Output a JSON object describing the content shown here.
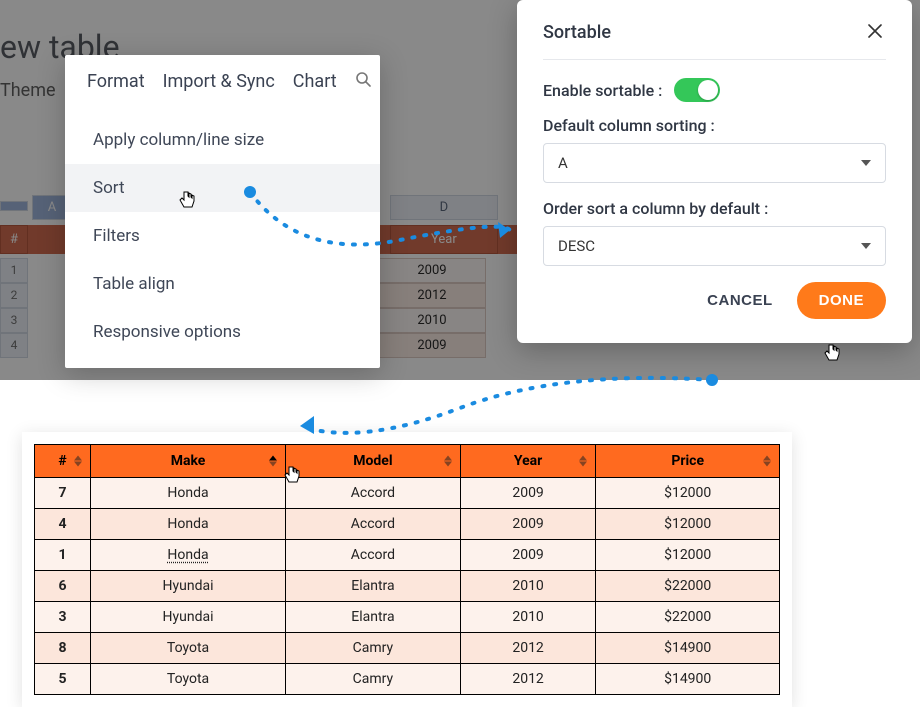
{
  "background": {
    "title": "ew table",
    "tabbar": "Theme",
    "col_headers": {
      "a": "A",
      "d": "D"
    },
    "sheet_headers": {
      "hash": "#",
      "year": "Year"
    },
    "rows": [
      {
        "idx": "1",
        "year": "2009"
      },
      {
        "idx": "2",
        "year": "2012"
      },
      {
        "idx": "3",
        "year": "2010"
      },
      {
        "idx": "4",
        "year": "2009"
      }
    ]
  },
  "menu": {
    "tabs": {
      "format": "Format",
      "import": "Import & Sync",
      "chart": "Chart"
    },
    "items": {
      "apply_size": "Apply column/line size",
      "sort": "Sort",
      "filters": "Filters",
      "table_align": "Table align",
      "responsive": "Responsive options"
    }
  },
  "dialog": {
    "title": "Sortable",
    "enable_label": "Enable sortable :",
    "default_col_label": "Default column sorting :",
    "default_col_value": "A",
    "order_label": "Order sort a column by default :",
    "order_value": "DESC",
    "cancel": "CANCEL",
    "done": "DONE"
  },
  "result_table": {
    "headers": {
      "idx": "#",
      "make": "Make",
      "model": "Model",
      "year": "Year",
      "price": "Price"
    },
    "rows": [
      {
        "idx": "7",
        "make": "Honda",
        "model": "Accord",
        "year": "2009",
        "price": "$12000"
      },
      {
        "idx": "4",
        "make": "Honda",
        "model": "Accord",
        "year": "2009",
        "price": "$12000"
      },
      {
        "idx": "1",
        "make": "Honda",
        "model": "Accord",
        "year": "2009",
        "price": "$12000"
      },
      {
        "idx": "6",
        "make": "Hyundai",
        "model": "Elantra",
        "year": "2010",
        "price": "$22000"
      },
      {
        "idx": "3",
        "make": "Hyundai",
        "model": "Elantra",
        "year": "2010",
        "price": "$22000"
      },
      {
        "idx": "8",
        "make": "Toyota",
        "model": "Camry",
        "year": "2012",
        "price": "$14900"
      },
      {
        "idx": "5",
        "make": "Toyota",
        "model": "Camry",
        "year": "2012",
        "price": "$14900"
      }
    ]
  }
}
